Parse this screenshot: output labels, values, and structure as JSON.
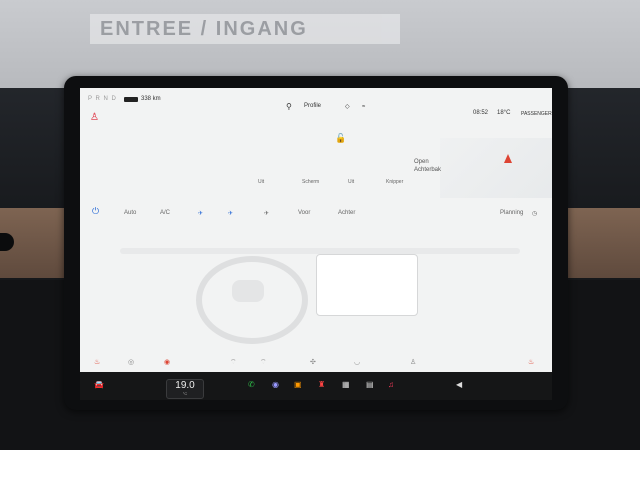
{
  "wall_sign": "ENTREE / INGANG",
  "top_bar": {
    "gear": "P R N D",
    "range": "338 km",
    "profile": "Profile",
    "time": "08:52",
    "temperature": "18°C",
    "airbag": "PASSENGER"
  },
  "vehicle": {
    "trunk_label": "Open",
    "trunk_sub": "Achterbak"
  },
  "tabs": [
    "Uit",
    "Scherm",
    "Uit",
    "Knipper"
  ],
  "climate": {
    "auto": "Auto",
    "ac": "A/C",
    "front": "Voor",
    "rear": "Achter",
    "planning": "Planning"
  },
  "dock": {
    "temperature": "19.0",
    "temp_sub": "°C"
  },
  "colors": {
    "accent": "#2a6bd6",
    "warning": "#d43333",
    "phone": "#2fbe4a",
    "music": "#ff3b5c"
  }
}
